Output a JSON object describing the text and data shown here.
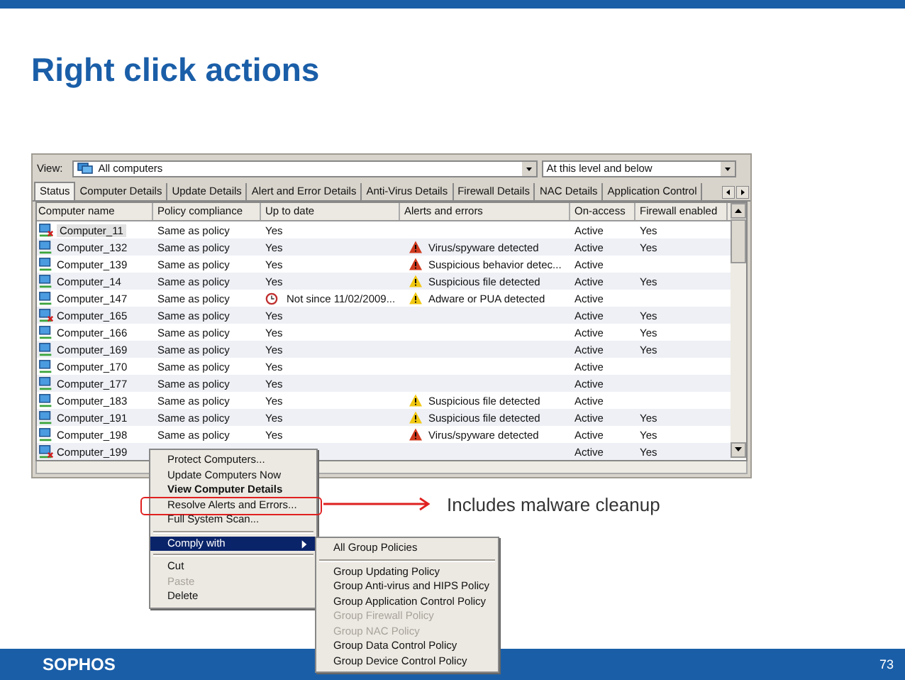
{
  "title": "Right click actions",
  "app": {
    "view_label": "View:",
    "view_value": "All computers",
    "scope_value": "At this level and below",
    "tabs": [
      {
        "label": "Status",
        "selected": true
      },
      {
        "label": "Computer Details",
        "selected": false
      },
      {
        "label": "Update Details",
        "selected": false
      },
      {
        "label": "Alert and Error Details",
        "selected": false
      },
      {
        "label": "Anti-Virus Details",
        "selected": false
      },
      {
        "label": "Firewall Details",
        "selected": false
      },
      {
        "label": "NAC Details",
        "selected": false
      },
      {
        "label": "Application Control",
        "selected": false
      }
    ],
    "columns": [
      "Computer name",
      "Policy compliance",
      "Up to date",
      "Alerts and errors",
      "On-access",
      "Firewall enabled"
    ],
    "rows": [
      {
        "name": "Computer_11",
        "error": true,
        "selected": true,
        "compliance": "Same as policy",
        "up_to_date": "Yes",
        "on_access": "Active",
        "firewall": "Yes"
      },
      {
        "name": "Computer_132",
        "error": false,
        "selected": false,
        "compliance": "Same as policy",
        "up_to_date": "Yes",
        "alert": {
          "text": "Virus/spyware detected",
          "color": "#d03a1e"
        },
        "on_access": "Active",
        "firewall": "Yes"
      },
      {
        "name": "Computer_139",
        "error": false,
        "selected": false,
        "compliance": "Same as policy",
        "up_to_date": "Yes",
        "alert": {
          "text": "Suspicious behavior detec...",
          "color": "#d03a1e"
        },
        "on_access": "Active"
      },
      {
        "name": "Computer_14",
        "error": false,
        "selected": false,
        "compliance": "Same as policy",
        "up_to_date": "Yes",
        "alert": {
          "text": "Suspicious file detected",
          "color": "#f2c811"
        },
        "on_access": "Active",
        "firewall": "Yes"
      },
      {
        "name": "Computer_147",
        "error": false,
        "selected": false,
        "compliance": "Same as policy",
        "up_to_date": "Not since 11/02/2009...",
        "outdated": true,
        "alert": {
          "text": "Adware or PUA detected",
          "color": "#f2c811"
        },
        "on_access": "Active"
      },
      {
        "name": "Computer_165",
        "error": true,
        "selected": false,
        "compliance": "Same as policy",
        "up_to_date": "Yes",
        "on_access": "Active",
        "firewall": "Yes"
      },
      {
        "name": "Computer_166",
        "error": false,
        "selected": false,
        "compliance": "Same as policy",
        "up_to_date": "Yes",
        "on_access": "Active",
        "firewall": "Yes"
      },
      {
        "name": "Computer_169",
        "error": false,
        "selected": false,
        "compliance": "Same as policy",
        "up_to_date": "Yes",
        "on_access": "Active",
        "firewall": "Yes"
      },
      {
        "name": "Computer_170",
        "error": false,
        "selected": false,
        "compliance": "Same as policy",
        "up_to_date": "Yes",
        "on_access": "Active"
      },
      {
        "name": "Computer_177",
        "error": false,
        "selected": false,
        "compliance": "Same as policy",
        "up_to_date": "Yes",
        "on_access": "Active"
      },
      {
        "name": "Computer_183",
        "error": false,
        "selected": false,
        "compliance": "Same as policy",
        "up_to_date": "Yes",
        "alert": {
          "text": "Suspicious file detected",
          "color": "#f2c811"
        },
        "on_access": "Active"
      },
      {
        "name": "Computer_191",
        "error": false,
        "selected": false,
        "compliance": "Same as policy",
        "up_to_date": "Yes",
        "alert": {
          "text": "Suspicious file detected",
          "color": "#f2c811"
        },
        "on_access": "Active",
        "firewall": "Yes"
      },
      {
        "name": "Computer_198",
        "error": false,
        "selected": false,
        "compliance": "Same as policy",
        "up_to_date": "Yes",
        "alert": {
          "text": "Virus/spyware detected",
          "color": "#d03a1e"
        },
        "on_access": "Active",
        "firewall": "Yes"
      },
      {
        "name": "Computer_199",
        "error": true,
        "selected": false,
        "on_access": "Active",
        "firewall": "Yes"
      }
    ]
  },
  "context_menu": [
    {
      "kind": "item",
      "label": "Protect Computers...",
      "default": false,
      "disabled": false,
      "selected": false,
      "submenu": false,
      "callout": false
    },
    {
      "kind": "item",
      "label": "Update Computers Now",
      "default": false,
      "disabled": false,
      "selected": false,
      "submenu": false,
      "callout": false
    },
    {
      "kind": "item",
      "label": "View Computer Details",
      "default": true,
      "disabled": false,
      "selected": false,
      "submenu": false,
      "callout": false
    },
    {
      "kind": "item",
      "label": "Resolve Alerts and Errors...",
      "default": false,
      "disabled": false,
      "selected": false,
      "submenu": false,
      "callout": true
    },
    {
      "kind": "item",
      "label": "Full System Scan...",
      "default": false,
      "disabled": false,
      "selected": false,
      "submenu": false,
      "callout": false
    },
    {
      "kind": "separator"
    },
    {
      "kind": "item",
      "label": "Comply with",
      "default": false,
      "disabled": false,
      "selected": true,
      "submenu": true,
      "callout": false
    },
    {
      "kind": "separator"
    },
    {
      "kind": "item",
      "label": "Cut",
      "default": false,
      "disabled": false,
      "selected": false,
      "submenu": false,
      "callout": false
    },
    {
      "kind": "item",
      "label": "Paste",
      "default": false,
      "disabled": true,
      "selected": false,
      "submenu": false,
      "callout": false
    },
    {
      "kind": "item",
      "label": "Delete",
      "default": false,
      "disabled": false,
      "selected": false,
      "submenu": false,
      "callout": false
    }
  ],
  "submenu": [
    {
      "kind": "item",
      "label": "All Group Policies",
      "disabled": false
    },
    {
      "kind": "separator"
    },
    {
      "kind": "item",
      "label": "Group Updating Policy",
      "disabled": false
    },
    {
      "kind": "item",
      "label": "Group Anti-virus and HIPS Policy",
      "disabled": false
    },
    {
      "kind": "item",
      "label": "Group Application Control Policy",
      "disabled": false
    },
    {
      "kind": "item",
      "label": "Group Firewall Policy",
      "disabled": true
    },
    {
      "kind": "item",
      "label": "Group NAC Policy",
      "disabled": true
    },
    {
      "kind": "item",
      "label": "Group Data Control Policy",
      "disabled": false
    },
    {
      "kind": "item",
      "label": "Group Device Control Policy",
      "disabled": false
    }
  ],
  "callout_text": "Includes malware cleanup",
  "footer": {
    "logo": "SOPHOS",
    "page": "73"
  }
}
